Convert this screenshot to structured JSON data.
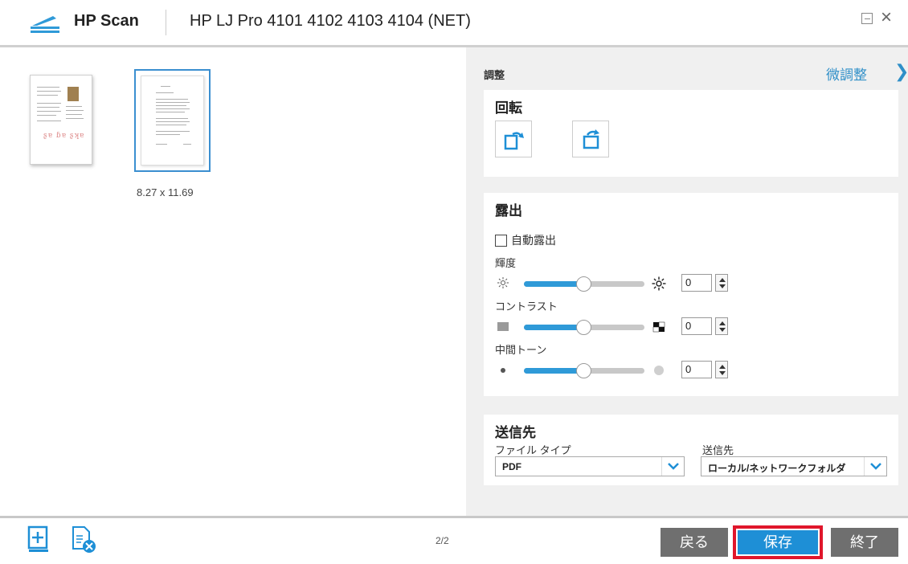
{
  "titlebar": {
    "app_name": "HP Scan",
    "device_name": "HP LJ Pro 4101 4102 4103 4104 (NET)",
    "minimize_icon": "minimize-icon",
    "close_glyph": "×"
  },
  "preview": {
    "thumbnails": [
      {
        "name": "page-1",
        "selected": false
      },
      {
        "name": "page-2",
        "selected": true
      }
    ],
    "page_size": "8.27 x 11.69"
  },
  "settings": {
    "adjust_label": "調整",
    "fine_tune_link": "微調整",
    "chevron": "❯",
    "rotation": {
      "title": "回転",
      "buttons": [
        "rotate-right-icon",
        "rotate-left-icon"
      ]
    },
    "exposure": {
      "title": "露出",
      "auto_label": "自動露出",
      "auto_checked": false,
      "brightness": {
        "label": "輝度",
        "value": "0",
        "level": 0.5
      },
      "contrast": {
        "label": "コントラスト",
        "value": "0",
        "level": 0.5
      },
      "midtone": {
        "label": "中間トーン",
        "value": "0",
        "level": 0.5
      }
    },
    "destination": {
      "title": "送信先",
      "file_type_label": "ファイル タイプ",
      "file_type_value": "PDF",
      "dest_label": "送信先",
      "dest_value": "ローカル/ネットワークフォルダ"
    }
  },
  "bottombar": {
    "page_indicator": "2/2",
    "back_label": "戻る",
    "save_label": "保存",
    "end_label": "終了"
  },
  "colors": {
    "accent": "#2f9ad8",
    "highlight_border": "#e0162b",
    "button_gray": "#6f6f6f"
  }
}
